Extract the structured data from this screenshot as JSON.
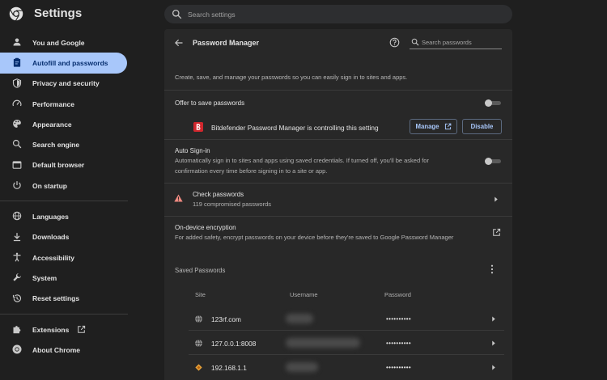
{
  "header": {
    "title": "Settings",
    "search_placeholder": "Search settings"
  },
  "sidebar": {
    "items": [
      {
        "label": "You and Google",
        "icon": "person-icon"
      },
      {
        "label": "Autofill and passwords",
        "icon": "clipboard-icon",
        "active": true
      },
      {
        "label": "Privacy and security",
        "icon": "shield-icon"
      },
      {
        "label": "Performance",
        "icon": "speedometer-icon"
      },
      {
        "label": "Appearance",
        "icon": "palette-icon"
      },
      {
        "label": "Search engine",
        "icon": "search-icon"
      },
      {
        "label": "Default browser",
        "icon": "browser-window-icon"
      },
      {
        "label": "On startup",
        "icon": "power-icon"
      }
    ],
    "items2": [
      {
        "label": "Languages",
        "icon": "globe-icon"
      },
      {
        "label": "Downloads",
        "icon": "download-icon"
      },
      {
        "label": "Accessibility",
        "icon": "accessibility-icon"
      },
      {
        "label": "System",
        "icon": "wrench-icon"
      },
      {
        "label": "Reset settings",
        "icon": "history-icon"
      }
    ],
    "items3": [
      {
        "label": "Extensions",
        "icon": "puzzle-icon"
      },
      {
        "label": "About Chrome",
        "icon": "chrome-icon"
      }
    ]
  },
  "password_manager": {
    "title": "Password Manager",
    "search_placeholder": "Search passwords",
    "description": "Create, save, and manage your passwords so you can easily sign in to sites and apps.",
    "offer_to_save": {
      "label": "Offer to save passwords",
      "enabled": false
    },
    "controller": {
      "text": "Bitdefender Password Manager is controlling this setting",
      "manage_label": "Manage",
      "disable_label": "Disable"
    },
    "auto_signin": {
      "label": "Auto Sign-in",
      "description_line1": "Automatically sign in to sites and apps using saved credentials. If turned off, you'll be asked for",
      "description_line2": "confirmation every time before signing in to a site or app.",
      "enabled": false
    },
    "check_passwords": {
      "label": "Check passwords",
      "subtitle": "119 compromised passwords"
    },
    "encryption": {
      "label": "On-device encryption",
      "description": "For added safety, encrypt passwords on your device before they're saved to Google Password Manager"
    },
    "saved": {
      "label": "Saved Passwords",
      "columns": [
        "Site",
        "Username",
        "Password"
      ],
      "rows": [
        {
          "site": "123rf.com",
          "password": "••••••••••",
          "icon": "globe-icon"
        },
        {
          "site": "127.0.0.1:8008",
          "password": "••••••••••",
          "icon": "globe-icon"
        },
        {
          "site": "192.168.1.1",
          "password": "••••••••••",
          "icon": "router-icon"
        }
      ]
    }
  },
  "colors": {
    "background": "#1f1f1f",
    "panel": "#282828",
    "accent": "#a8c7fa",
    "active_text": "#062e6f",
    "bitdefender_red": "#d0272d"
  }
}
